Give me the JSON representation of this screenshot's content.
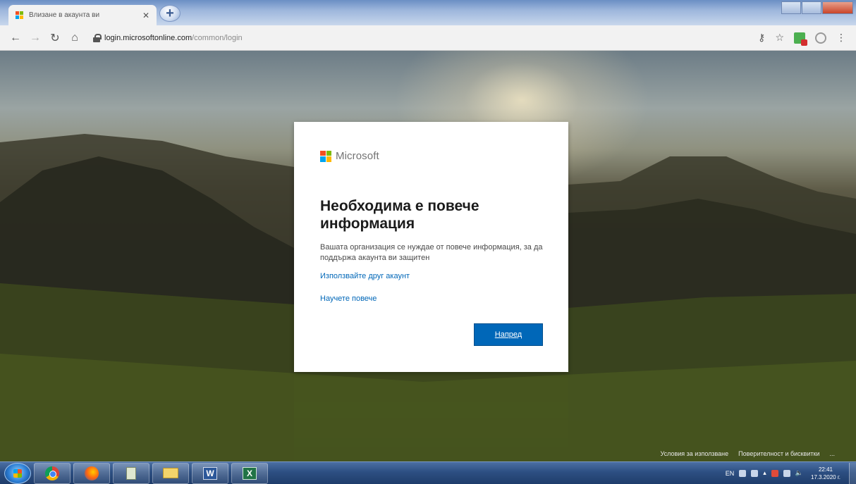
{
  "browser": {
    "tab": {
      "title": "Влизане в акаунта ви"
    },
    "address": {
      "host": "login.microsoftonline.com",
      "path": "/common/login"
    }
  },
  "colors": {
    "ms_red": "#f25022",
    "ms_green": "#7fba00",
    "ms_blue": "#00a4ef",
    "ms_yellow": "#ffb900",
    "accent": "#0067b8"
  },
  "card": {
    "brand": "Microsoft",
    "title": "Необходима е повече информация",
    "description": "Вашата организация се нуждае от повече информация, за да поддържа акаунта ви защитен",
    "link_other_account": "Използвайте друг акаунт",
    "link_learn_more": "Научете повече",
    "next_button": "Напред"
  },
  "footer": {
    "terms": "Условия за използване",
    "privacy": "Поверителност и бисквитки"
  },
  "taskbar": {
    "language": "EN",
    "time": "22:41",
    "date": "17.3.2020 г."
  }
}
